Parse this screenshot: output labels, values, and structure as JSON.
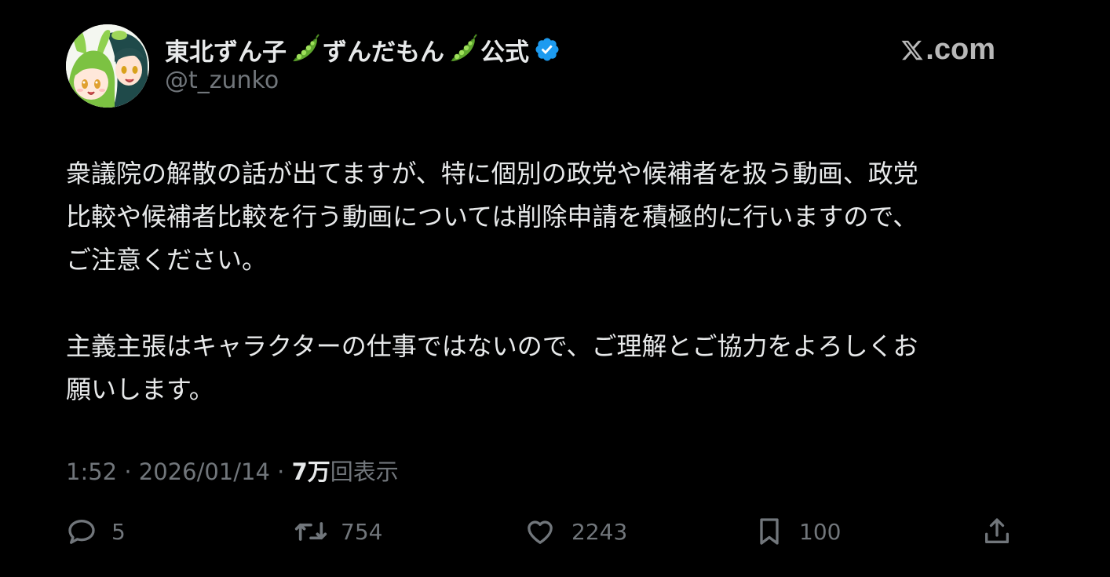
{
  "post": {
    "author": {
      "display_name_part1": "東北ずん子",
      "display_name_part2": "ずんだもん",
      "display_name_part3": "公式",
      "handle": "@t_zunko"
    },
    "brand": ".com",
    "body": {
      "paragraph1": [
        "衆議院の解散の話が出てますが、特に個別の政党や候補者を扱う動画、政党",
        "比較や候補者比較を行う動画については削除申請を積極的に行いますので、",
        "ご注意ください。"
      ],
      "paragraph2": [
        "主義主張はキャラクターの仕事ではないので、ご理解とご協力をよろしくお",
        "願いします。"
      ]
    },
    "meta": {
      "time": "1:52",
      "separator": " · ",
      "date": "2026/01/14",
      "views_count": "7万",
      "views_label": "回表示"
    },
    "actions": {
      "replies": "5",
      "reposts": "754",
      "likes": "2243",
      "bookmarks": "100"
    }
  },
  "icons": {
    "pea": "pea-pod-icon",
    "verified": "verified-badge-icon",
    "brand": "x-logo-icon",
    "reply": "reply-icon",
    "repost": "repost-icon",
    "like": "heart-icon",
    "bookmark": "bookmark-icon",
    "share": "share-icon"
  },
  "colors": {
    "background": "#000000",
    "primary_text": "#e7e9ea",
    "secondary_text": "#71767b",
    "verified": "#1d9bf0",
    "pea_green": "#7cc242"
  }
}
